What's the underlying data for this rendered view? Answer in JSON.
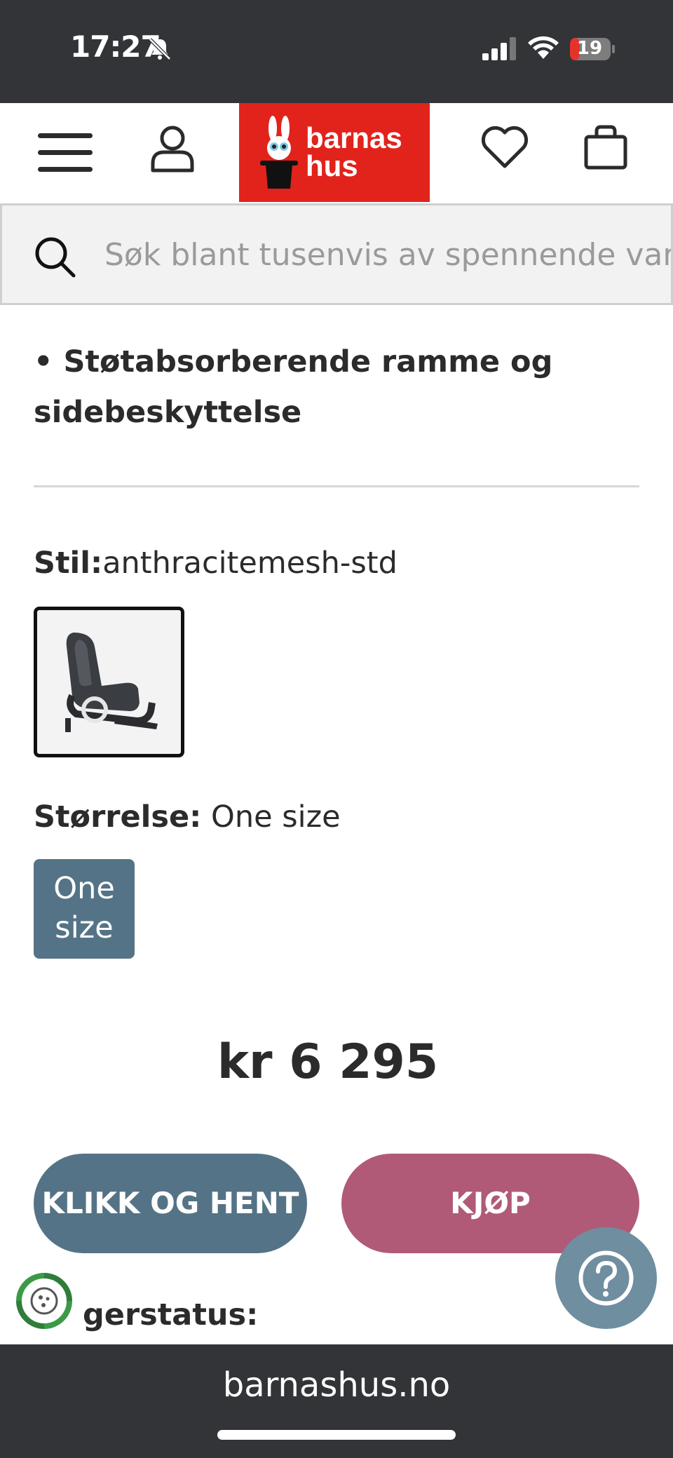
{
  "status_bar": {
    "time": "17:27",
    "battery": "19"
  },
  "header": {
    "logo_line1": "barnas",
    "logo_line2": "hus"
  },
  "search": {
    "placeholder": "Søk blant tusenvis av spennende varer"
  },
  "product": {
    "feature_bullet": "• Støtabsorberende ramme og sidebeskyttelse",
    "style_label": "Stil:",
    "style_value": "anthracitemesh-std",
    "size_label": "Størrelse:",
    "size_value": " One size",
    "size_option": "One size",
    "price": "kr 6 295",
    "stock_label_partial": "gerstatus:"
  },
  "actions": {
    "click_collect": "KLIKK OG HENT",
    "buy": "KJØP"
  },
  "browser": {
    "url": "barnashus.no"
  },
  "colors": {
    "brand_red": "#e1231c",
    "slate_blue": "#557386",
    "buy_pink": "#b05a78",
    "dark_bar": "#323438"
  }
}
